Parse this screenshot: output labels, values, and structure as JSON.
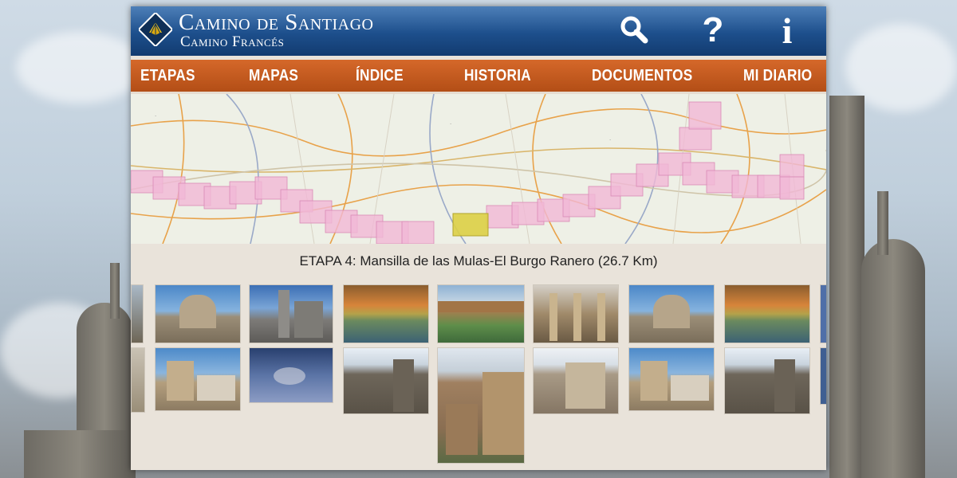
{
  "app": {
    "title_line1": "Camino de Santiago",
    "title_line2": "Camino Francés"
  },
  "header_icons": [
    "search-icon",
    "help-icon",
    "info-icon"
  ],
  "header_glyphs": {
    "help": "?",
    "info": "i"
  },
  "nav": {
    "items": [
      "ETAPAS",
      "MAPAS",
      "ÍNDICE",
      "HISTORIA",
      "DOCUMENTOS",
      "MI DIARIO"
    ]
  },
  "stage": {
    "title": "ETAPA 4: Mansilla de las Mulas-El Burgo Ranero (26.7 Km)"
  },
  "gallery": {
    "row1": [
      "round church",
      "gothic cathedral",
      "autumn lake",
      "stone bridge",
      "arcade columns",
      "round church",
      "autumn lake"
    ],
    "row2": [
      "chapel",
      "aerial town",
      "castle",
      "old street",
      "town square",
      "chapel",
      "castle"
    ]
  },
  "colors": {
    "header_blue": "#1d4f8c",
    "nav_orange": "#c45b20",
    "panel_beige": "#e9e3da",
    "map_highlight": "#e8b0cf",
    "current_stage": "#dccf45"
  }
}
